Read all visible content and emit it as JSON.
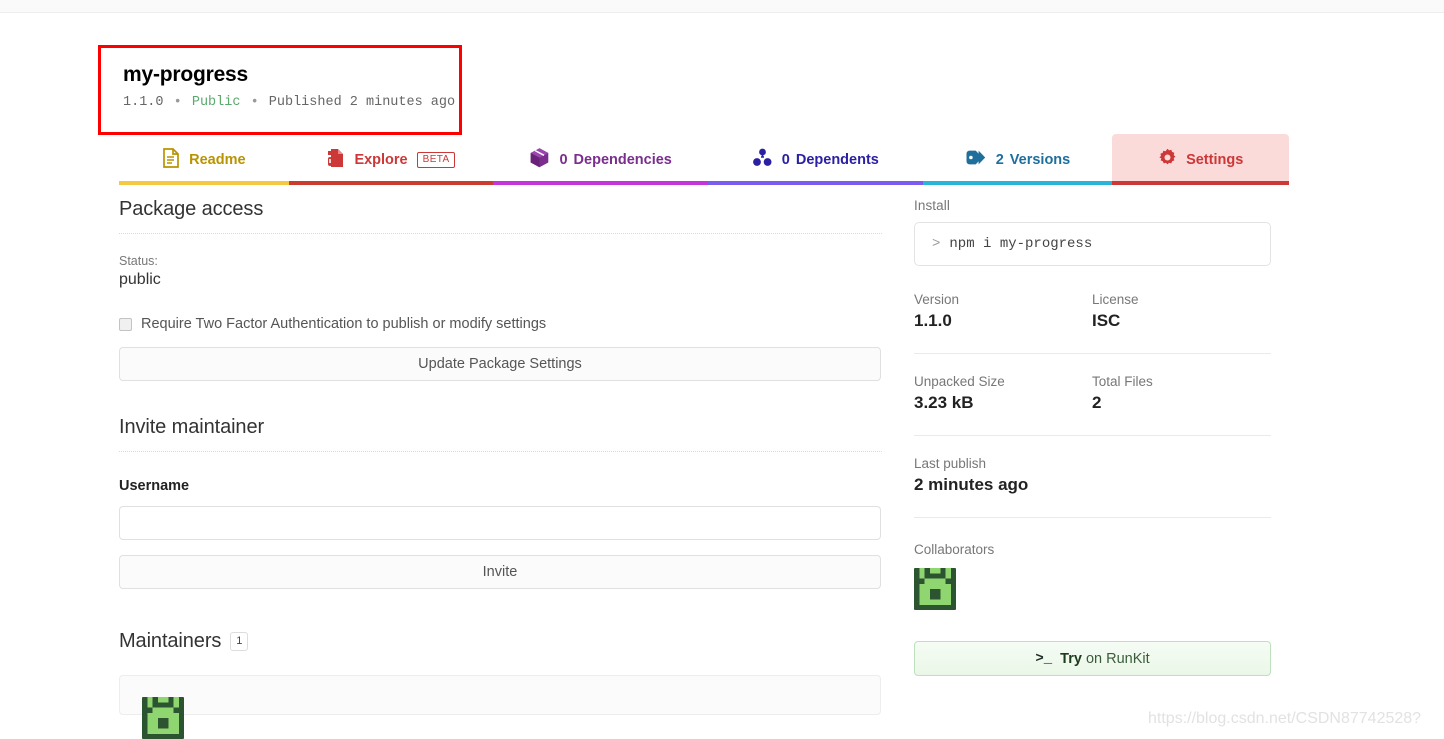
{
  "package": {
    "name": "my-progress",
    "version_line": {
      "version": "1.1.0",
      "visibility": "Public",
      "published": "Published 2 minutes ago",
      "separator": "•"
    }
  },
  "tabs": [
    {
      "icon": "readme-document-icon",
      "count": "",
      "label": "Readme",
      "badge": "",
      "color": "#b99400",
      "underline": "#f5c842"
    },
    {
      "icon": "explore-file-icon",
      "count": "",
      "label": "Explore",
      "badge": "BETA",
      "color": "#cb3837",
      "underline": "#cb3c2e"
    },
    {
      "icon": "package-cube-icon",
      "count": "0",
      "label": "Dependencies",
      "badge": "",
      "color": "#7a2e8e",
      "underline": "#c434d8"
    },
    {
      "icon": "dependents-nodes-icon",
      "count": "0",
      "label": "Dependents",
      "badge": "",
      "color": "#2b20a3",
      "underline": "#7b5cf0"
    },
    {
      "icon": "version-tag-icon",
      "count": "2",
      "label": "Versions",
      "badge": "",
      "color": "#1f6f9c",
      "underline": "#29b5d8"
    },
    {
      "icon": "gear-settings-icon",
      "count": "",
      "label": "Settings",
      "badge": "",
      "color": "#cb3837",
      "underline": "#cb3837"
    }
  ],
  "package_access": {
    "title": "Package access",
    "status_label": "Status:",
    "status_value": "public",
    "two_factor_label": "Require Two Factor Authentication to publish or modify settings",
    "two_factor_checked": false,
    "update_button": "Update Package Settings"
  },
  "invite_maintainer": {
    "title": "Invite maintainer",
    "username_label": "Username",
    "username_value": "",
    "username_placeholder": "",
    "invite_button": "Invite"
  },
  "maintainers": {
    "title": "Maintainers",
    "count": "1"
  },
  "sidebar": {
    "install": {
      "label": "Install",
      "prompt": ">",
      "command": "npm i my-progress"
    },
    "version": {
      "key": "Version",
      "value": "1.1.0"
    },
    "license": {
      "key": "License",
      "value": "ISC"
    },
    "unpacked_size": {
      "key": "Unpacked Size",
      "value": "3.23 kB"
    },
    "total_files": {
      "key": "Total Files",
      "value": "2"
    },
    "last_publish": {
      "key": "Last publish",
      "value": "2 minutes ago"
    },
    "collaborators": {
      "label": "Collaborators",
      "avatar_name": "collaborator-identicon"
    },
    "runkit": {
      "prompt": ">_",
      "bold_text": "Try",
      "rest_text": " on RunKit"
    }
  },
  "watermark": "https://blog.csdn.net/CSDN87742528?",
  "colors": {
    "npm_red": "#cb3837",
    "annotation_red": "#ff0000",
    "public_green": "#5aab6b",
    "settings_tab_bg": "#fbdada"
  }
}
